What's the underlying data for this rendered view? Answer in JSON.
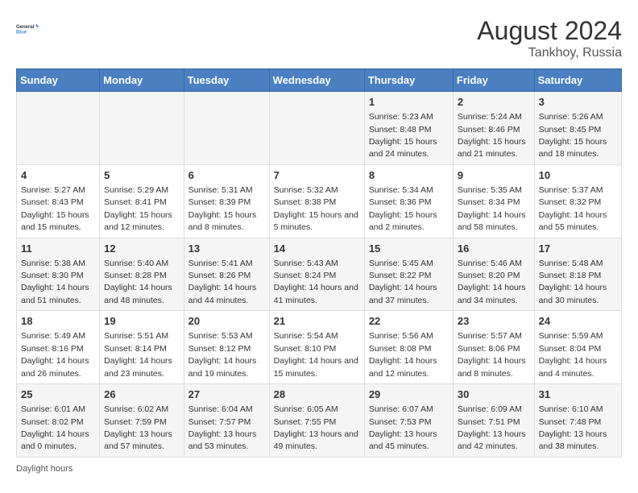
{
  "header": {
    "logo_text_general": "General",
    "logo_text_blue": "Blue",
    "month_year": "August 2024",
    "location": "Tankhoy, Russia"
  },
  "days_of_week": [
    "Sunday",
    "Monday",
    "Tuesday",
    "Wednesday",
    "Thursday",
    "Friday",
    "Saturday"
  ],
  "weeks": [
    [
      {
        "day": "",
        "detail": ""
      },
      {
        "day": "",
        "detail": ""
      },
      {
        "day": "",
        "detail": ""
      },
      {
        "day": "",
        "detail": ""
      },
      {
        "day": "1",
        "detail": "Sunrise: 5:23 AM\nSunset: 8:48 PM\nDaylight: 15 hours and 24 minutes."
      },
      {
        "day": "2",
        "detail": "Sunrise: 5:24 AM\nSunset: 8:46 PM\nDaylight: 15 hours and 21 minutes."
      },
      {
        "day": "3",
        "detail": "Sunrise: 5:26 AM\nSunset: 8:45 PM\nDaylight: 15 hours and 18 minutes."
      }
    ],
    [
      {
        "day": "4",
        "detail": "Sunrise: 5:27 AM\nSunset: 8:43 PM\nDaylight: 15 hours and 15 minutes."
      },
      {
        "day": "5",
        "detail": "Sunrise: 5:29 AM\nSunset: 8:41 PM\nDaylight: 15 hours and 12 minutes."
      },
      {
        "day": "6",
        "detail": "Sunrise: 5:31 AM\nSunset: 8:39 PM\nDaylight: 15 hours and 8 minutes."
      },
      {
        "day": "7",
        "detail": "Sunrise: 5:32 AM\nSunset: 8:38 PM\nDaylight: 15 hours and 5 minutes."
      },
      {
        "day": "8",
        "detail": "Sunrise: 5:34 AM\nSunset: 8:36 PM\nDaylight: 15 hours and 2 minutes."
      },
      {
        "day": "9",
        "detail": "Sunrise: 5:35 AM\nSunset: 8:34 PM\nDaylight: 14 hours and 58 minutes."
      },
      {
        "day": "10",
        "detail": "Sunrise: 5:37 AM\nSunset: 8:32 PM\nDaylight: 14 hours and 55 minutes."
      }
    ],
    [
      {
        "day": "11",
        "detail": "Sunrise: 5:38 AM\nSunset: 8:30 PM\nDaylight: 14 hours and 51 minutes."
      },
      {
        "day": "12",
        "detail": "Sunrise: 5:40 AM\nSunset: 8:28 PM\nDaylight: 14 hours and 48 minutes."
      },
      {
        "day": "13",
        "detail": "Sunrise: 5:41 AM\nSunset: 8:26 PM\nDaylight: 14 hours and 44 minutes."
      },
      {
        "day": "14",
        "detail": "Sunrise: 5:43 AM\nSunset: 8:24 PM\nDaylight: 14 hours and 41 minutes."
      },
      {
        "day": "15",
        "detail": "Sunrise: 5:45 AM\nSunset: 8:22 PM\nDaylight: 14 hours and 37 minutes."
      },
      {
        "day": "16",
        "detail": "Sunrise: 5:46 AM\nSunset: 8:20 PM\nDaylight: 14 hours and 34 minutes."
      },
      {
        "day": "17",
        "detail": "Sunrise: 5:48 AM\nSunset: 8:18 PM\nDaylight: 14 hours and 30 minutes."
      }
    ],
    [
      {
        "day": "18",
        "detail": "Sunrise: 5:49 AM\nSunset: 8:16 PM\nDaylight: 14 hours and 26 minutes."
      },
      {
        "day": "19",
        "detail": "Sunrise: 5:51 AM\nSunset: 8:14 PM\nDaylight: 14 hours and 23 minutes."
      },
      {
        "day": "20",
        "detail": "Sunrise: 5:53 AM\nSunset: 8:12 PM\nDaylight: 14 hours and 19 minutes."
      },
      {
        "day": "21",
        "detail": "Sunrise: 5:54 AM\nSunset: 8:10 PM\nDaylight: 14 hours and 15 minutes."
      },
      {
        "day": "22",
        "detail": "Sunrise: 5:56 AM\nSunset: 8:08 PM\nDaylight: 14 hours and 12 minutes."
      },
      {
        "day": "23",
        "detail": "Sunrise: 5:57 AM\nSunset: 8:06 PM\nDaylight: 14 hours and 8 minutes."
      },
      {
        "day": "24",
        "detail": "Sunrise: 5:59 AM\nSunset: 8:04 PM\nDaylight: 14 hours and 4 minutes."
      }
    ],
    [
      {
        "day": "25",
        "detail": "Sunrise: 6:01 AM\nSunset: 8:02 PM\nDaylight: 14 hours and 0 minutes."
      },
      {
        "day": "26",
        "detail": "Sunrise: 6:02 AM\nSunset: 7:59 PM\nDaylight: 13 hours and 57 minutes."
      },
      {
        "day": "27",
        "detail": "Sunrise: 6:04 AM\nSunset: 7:57 PM\nDaylight: 13 hours and 53 minutes."
      },
      {
        "day": "28",
        "detail": "Sunrise: 6:05 AM\nSunset: 7:55 PM\nDaylight: 13 hours and 49 minutes."
      },
      {
        "day": "29",
        "detail": "Sunrise: 6:07 AM\nSunset: 7:53 PM\nDaylight: 13 hours and 45 minutes."
      },
      {
        "day": "30",
        "detail": "Sunrise: 6:09 AM\nSunset: 7:51 PM\nDaylight: 13 hours and 42 minutes."
      },
      {
        "day": "31",
        "detail": "Sunrise: 6:10 AM\nSunset: 7:48 PM\nDaylight: 13 hours and 38 minutes."
      }
    ]
  ],
  "footer": {
    "text": "Daylight hours"
  }
}
